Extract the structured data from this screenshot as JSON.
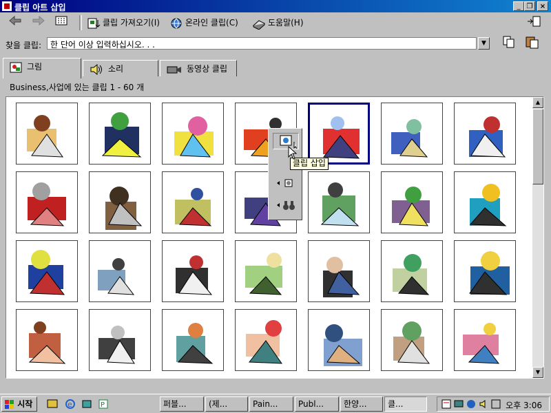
{
  "window": {
    "title": "클립 아트 삽입"
  },
  "toolbar": {
    "import_label": "클립 가져오기(I)",
    "online_label": "온라인 클립(C)",
    "help_label": "도움말(H)"
  },
  "search": {
    "label": "찾을 클립:",
    "value": "한 단어 이상 입력하십시오. . ."
  },
  "tabs": [
    {
      "label": "그림"
    },
    {
      "label": "소리"
    },
    {
      "label": "동영상 클립"
    }
  ],
  "status": "Business,사업에 있는 클립 1 - 60 개",
  "tooltip": "클립 삽입",
  "taskbar": {
    "start": "시작",
    "tasks": [
      {
        "label": "퍼블..."
      },
      {
        "label": "(제..."
      },
      {
        "label": "Pain..."
      },
      {
        "label": "Publ..."
      },
      {
        "label": "한양..."
      },
      {
        "label": "클..."
      }
    ],
    "clock": "오후 3:06"
  }
}
